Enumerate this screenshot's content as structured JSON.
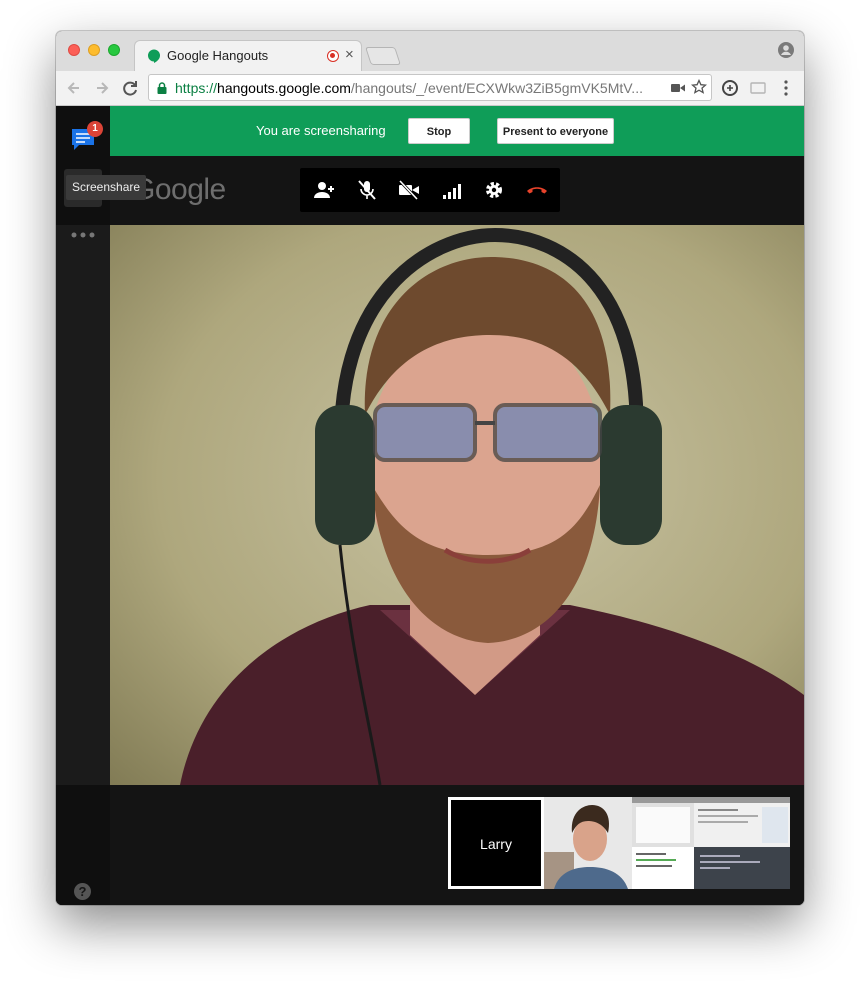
{
  "browser": {
    "tab_title": "Google Hangouts",
    "tab_close": "×",
    "url": {
      "scheme": "https://",
      "host": "hangouts.google.com",
      "path": "/hangouts/_/event/ECXWkw3ZiB5gmVK5MtV..."
    }
  },
  "sidebar": {
    "chat_badge_count": "1",
    "tooltip": "Screenshare",
    "help_label": "?"
  },
  "banner": {
    "status_text": "You are screensharing",
    "stop_label": "Stop",
    "present_label": "Present to everyone",
    "color": "#0f9d58"
  },
  "header": {
    "logo_text": "Google"
  },
  "controls": [
    {
      "icon": "add-person-icon"
    },
    {
      "icon": "mic-muted-icon"
    },
    {
      "icon": "camera-off-icon"
    },
    {
      "icon": "signal-bars-icon"
    },
    {
      "icon": "settings-icon"
    },
    {
      "icon": "hang-up-icon",
      "color": "#e8432b"
    }
  ],
  "filmstrip": {
    "participants": [
      {
        "name": "Larry",
        "selected": true
      },
      {
        "icon": "participant-video-icon"
      },
      {
        "icon": "screenshare-preview-icon"
      }
    ]
  }
}
